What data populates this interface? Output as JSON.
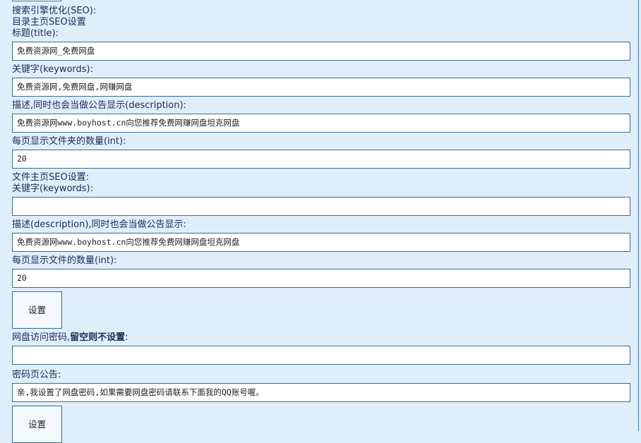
{
  "seo_section_title": "搜索引擎优化(SEO):",
  "dir_home": {
    "heading": "目录主页SEO设置",
    "title_label": "标题(title):",
    "title_value": "免费资源网_免费网盘",
    "keywords_label": "关键字(keywords):",
    "keywords_value": "免费资源网,免费网盘,网赚网盘",
    "description_label": "描述,同时也会当做公告显示(description):",
    "description_value": "免费资源网www.boyhost.cn向您推荐免费网赚网盘坦克网盘",
    "folders_per_page_label": "每页显示文件夹的数量(int):",
    "folders_per_page_value": "20"
  },
  "file_home": {
    "heading": "文件主页SEO设置:",
    "keywords_label": "关键字(keywords):",
    "keywords_value": "",
    "description_label": "描述(description),同时也会当做公告显示:",
    "description_value": "免费资源网www.boyhost.cn向您推荐免费网赚网盘坦克网盘",
    "files_per_page_label": "每页显示文件的数量(int):",
    "files_per_page_value": "20"
  },
  "set_button_1": "设置",
  "password": {
    "label_prefix": "网盘访问密码,",
    "label_bold": "留空则不设置",
    "label_suffix": ":",
    "value": ""
  },
  "notice": {
    "label": "密码页公告:",
    "value": "亲,我设置了网盘密码,如果需要网盘密码请联系下面我的QQ账号喔。"
  },
  "set_button_2": "设置"
}
